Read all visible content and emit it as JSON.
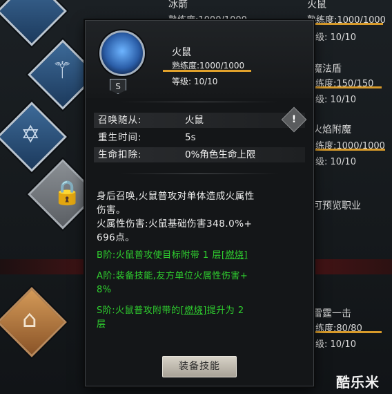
{
  "popup": {
    "name": "火鼠",
    "proficiency": "熟练度:1000/1000",
    "level": "等级: 10/10",
    "rank": "S",
    "stats": [
      {
        "key": "召唤随从:",
        "value": "火鼠"
      },
      {
        "key": "重生时间:",
        "value": "5s"
      },
      {
        "key": "生命扣除:",
        "value": "0%角色生命上限"
      }
    ],
    "warn_glyph": "!",
    "desc_line1": "身后召唤,火鼠普攻对单体造成火属性",
    "desc_line2": "伤害。",
    "desc_line3": "火属性伤害:火鼠基础伤害348.0%+",
    "desc_line4": "696点。",
    "tier_b_pre": "B阶:火鼠普攻使目标附带 1 层",
    "tier_b_link": "[燃烧]",
    "tier_a_line1": "A阶:装备技能,友方单位火属性伤害+",
    "tier_a_line2": "8%",
    "tier_s_pre": "S阶:火鼠普攻附带的",
    "tier_s_link": "[燃烧]",
    "tier_s_post": "提升为 2",
    "tier_s_line2": "层",
    "equip_label": "装备技能"
  },
  "background": {
    "col1_name": "冰箭",
    "col1_prof": "熟练度:1000/1000",
    "col2_name": "火鼠",
    "col2_prof": "熟练度:1000/1000",
    "r1_level": "级: 10/10",
    "r2_name": "魔法盾",
    "r2_prof": "练度:150/150",
    "r2_level": "级: 10/10",
    "r3_name": "火焰附魔",
    "r3_prof": "练度:1000/1000",
    "r3_level": "级: 10/10",
    "r4_text": "可预览职业",
    "r5_name": "雷霆一击",
    "r5_prof": "练度:80/80",
    "r5_level": "级: 10/10"
  },
  "watermark": "酷乐米",
  "colors": {
    "accent_bar": "#e0a12c",
    "tier_green": "#2fd12f",
    "popup_bg": "#141618"
  },
  "icons": [
    "lock-icon",
    "wand-icon",
    "star-icon",
    "fire-rat-icon",
    "warning-icon",
    "bow-icon"
  ]
}
